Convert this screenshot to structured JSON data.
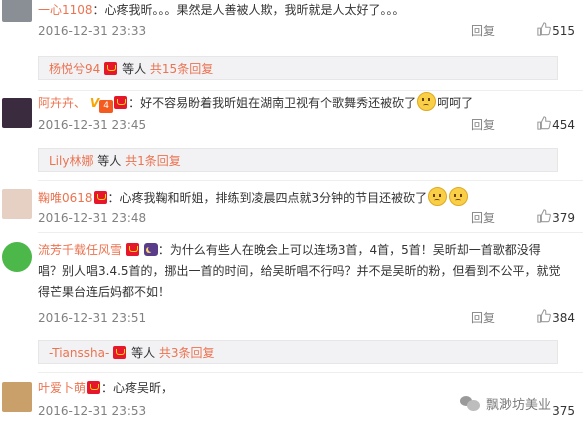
{
  "comments": [
    {
      "username": "一心1108",
      "text": "：心疼我昕。。。果然是人善被人欺，我昕就是人太好了。。。",
      "time": "2016-12-31 23:33",
      "reply_label": "回复",
      "likes": "515",
      "avatar_color": "#8a8f96",
      "sub": {
        "user": "杨悦兮94",
        "middle": " 等人 ",
        "total": "共15条回复"
      }
    },
    {
      "username": "阿卉卉、",
      "vip_label": "V",
      "level_badge": "4",
      "text_before": "：好不容易盼着我昕姐在湖南卫视有个歌舞秀还被砍了",
      "text_after": "呵呵了",
      "time": "2016-12-31 23:45",
      "reply_label": "回复",
      "likes": "454",
      "avatar_color": "#3a2c3e",
      "sub": {
        "user": "Lily林娜",
        "middle": " 等人 ",
        "total": "共1条回复"
      }
    },
    {
      "username": "鞠唯0618",
      "text": "：心疼我鞠和昕姐，排练到凌晨四点就3分钟的节目还被砍了",
      "time": "2016-12-31 23:48",
      "reply_label": "回复",
      "likes": "379",
      "avatar_color": "#d9c2b6"
    },
    {
      "username": "流芳千载任风雪",
      "line1": "：为什么有些人在晚会上可以连场3首，4首，5首！吴昕却一首歌都没得",
      "line2": "唱？别人唱3.4.5首的，挪出一首的时间，给吴昕唱不行吗？并不是吴昕的粉，但看到不公平，就觉",
      "line3": "得芒果台连后妈都不如！",
      "time": "2016-12-31 23:51",
      "reply_label": "回复",
      "likes": "384",
      "avatar_color": "#4cb84a",
      "sub": {
        "user": "-Tianssha-",
        "middle": " 等人 ",
        "total": "共3条回复"
      }
    },
    {
      "username": "叶爱卜萌",
      "text": "：心疼吴昕，",
      "time": "2016-12-31 23:53",
      "reply_label": "回复",
      "likes": "375",
      "avatar_color": "#c9a06a"
    }
  ],
  "watermark": {
    "text": "飘渺坊美业"
  },
  "colors": {
    "username": "#eb7350",
    "meta": "#808080",
    "sub_bg": "#f2f2f5"
  }
}
